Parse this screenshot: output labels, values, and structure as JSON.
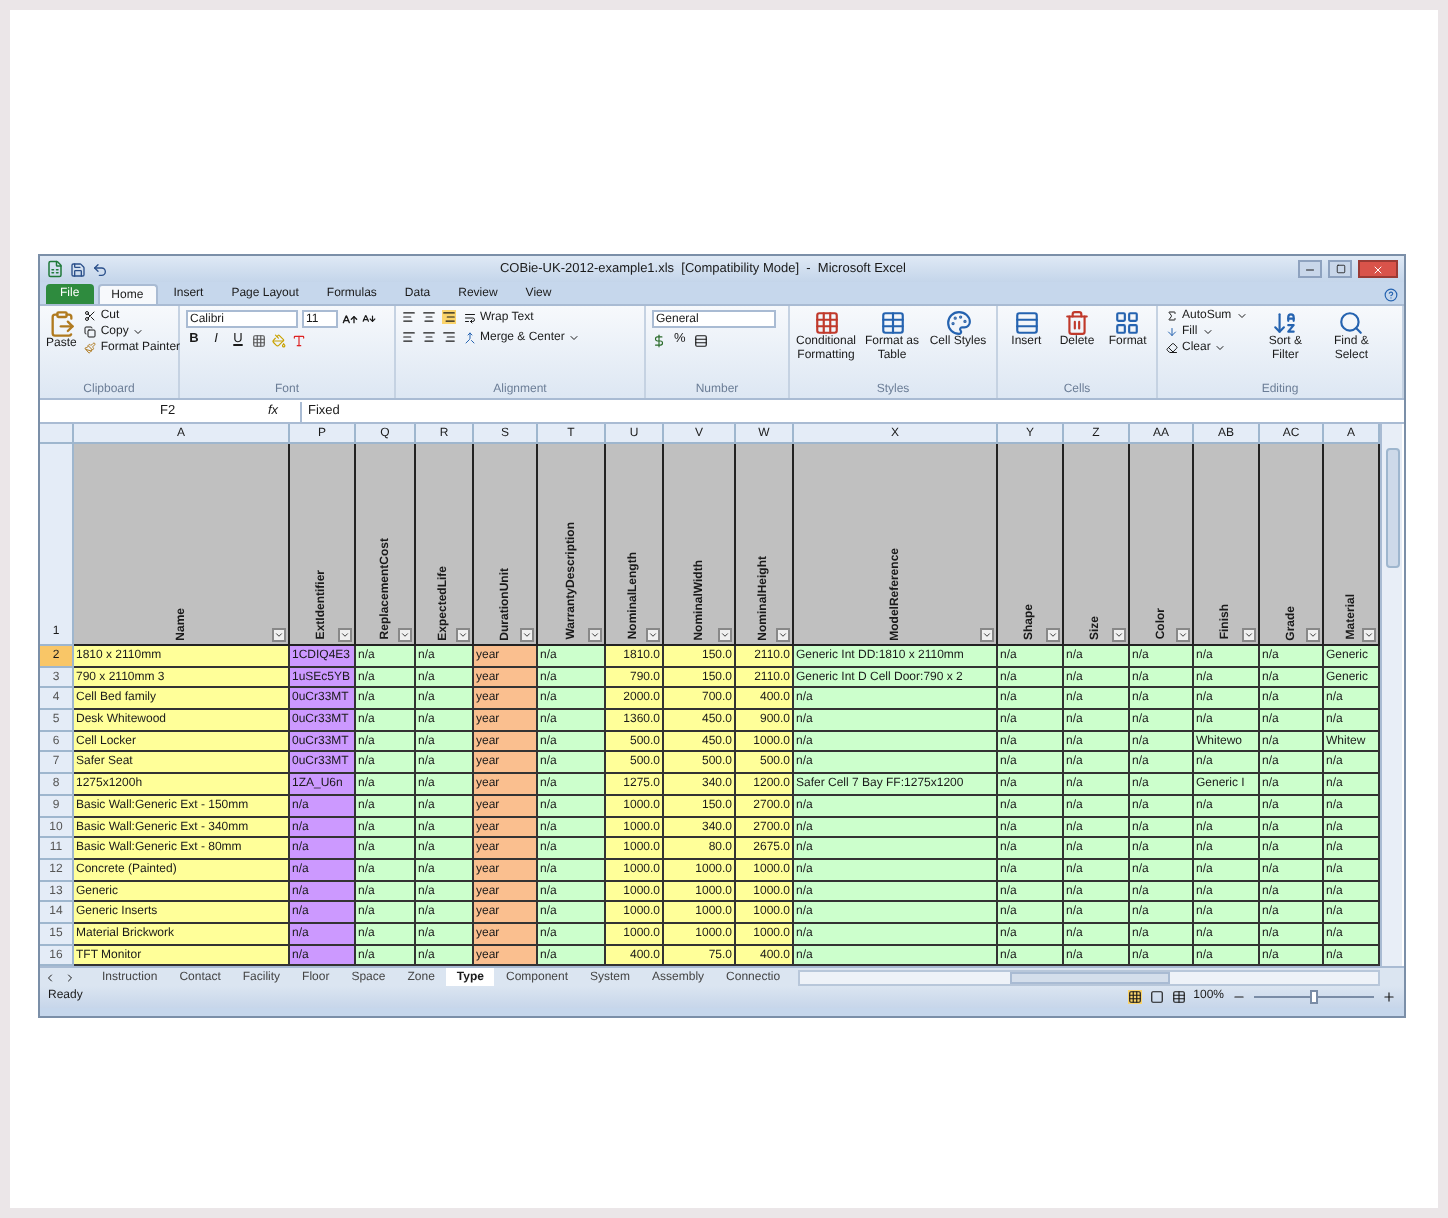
{
  "window": {
    "title": "COBie-UK-2012-example1.xls  [Compatibility Mode]  -  Microsoft Excel"
  },
  "ribbon_tabs": {
    "file": "File",
    "tabs": [
      {
        "label": "Home",
        "selected": true
      },
      {
        "label": "Insert",
        "selected": false
      },
      {
        "label": "Page Layout",
        "selected": false
      },
      {
        "label": "Formulas",
        "selected": false
      },
      {
        "label": "Data",
        "selected": false
      },
      {
        "label": "Review",
        "selected": false
      },
      {
        "label": "View",
        "selected": false
      }
    ]
  },
  "ribbon": {
    "clipboard": {
      "label": "Clipboard",
      "paste": "Paste",
      "cut": "Cut",
      "copy": "Copy",
      "format_painter": "Format Painter"
    },
    "font": {
      "label": "Font",
      "font_name": "Calibri",
      "font_size": "11",
      "styles": [
        "B",
        "I",
        "U"
      ]
    },
    "alignment": {
      "label": "Alignment",
      "wrap_text": "Wrap Text",
      "merge_center": "Merge & Center"
    },
    "number": {
      "label": "Number",
      "format": "General",
      "percent": "%"
    },
    "styles": {
      "label": "Styles",
      "buttons": [
        "Conditional Formatting",
        "Format as Table",
        "Cell Styles"
      ]
    },
    "cells": {
      "label": "Cells",
      "buttons": [
        "Insert",
        "Delete",
        "Format"
      ]
    },
    "editing": {
      "label": "Editing",
      "autosum": "AutoSum",
      "fill": "Fill",
      "clear": "Clear",
      "sort_filter": "Sort & Filter",
      "find_select": "Find & Select"
    }
  },
  "formula_bar": {
    "name_box": "F2",
    "fx": "fx",
    "value": "Fixed"
  },
  "header_row_number": "1",
  "columns": [
    {
      "letter": "A",
      "name": "Name",
      "color": "#ffff99",
      "kind": "text"
    },
    {
      "letter": "P",
      "name": "ExtIdentifier",
      "color": "#cc99ff",
      "kind": "text"
    },
    {
      "letter": "Q",
      "name": "ReplacementCost",
      "color": "#ccffcc",
      "kind": "text"
    },
    {
      "letter": "R",
      "name": "ExpectedLife",
      "color": "#ccffcc",
      "kind": "text"
    },
    {
      "letter": "S",
      "name": "DurationUnit",
      "color": "#fabf8f",
      "kind": "text"
    },
    {
      "letter": "T",
      "name": "WarrantyDescription",
      "color": "#ccffcc",
      "kind": "text"
    },
    {
      "letter": "U",
      "name": "NominalLength",
      "color": "#ffff99",
      "kind": "number"
    },
    {
      "letter": "V",
      "name": "NominalWidth",
      "color": "#ffff99",
      "kind": "number"
    },
    {
      "letter": "W",
      "name": "NominalHeight",
      "color": "#ffff99",
      "kind": "number"
    },
    {
      "letter": "X",
      "name": "ModelReference",
      "color": "#ccffcc",
      "kind": "text"
    },
    {
      "letter": "Y",
      "name": "Shape",
      "color": "#ccffcc",
      "kind": "text"
    },
    {
      "letter": "Z",
      "name": "Size",
      "color": "#ccffcc",
      "kind": "text"
    },
    {
      "letter": "AA",
      "name": "Color",
      "color": "#ccffcc",
      "kind": "text"
    },
    {
      "letter": "AB",
      "name": "Finish",
      "color": "#ccffcc",
      "kind": "text"
    },
    {
      "letter": "AC",
      "name": "Grade",
      "color": "#ccffcc",
      "kind": "text"
    },
    {
      "letter": "A",
      "name": "Material",
      "color": "#ccffcc",
      "kind": "text"
    }
  ],
  "rows": [
    {
      "number": "2",
      "selected": true,
      "cells": [
        "1810 x 2110mm",
        "1CDIQ4E3",
        "n/a",
        "n/a",
        "year",
        "n/a",
        "1810.0",
        "150.0",
        "2110.0",
        "Generic Int DD:1810 x 2110mm",
        "n/a",
        "n/a",
        "n/a",
        "n/a",
        "n/a",
        "Generic"
      ]
    },
    {
      "number": "3",
      "selected": false,
      "cells": [
        "790 x 2110mm 3",
        "1uSEc5YB",
        "n/a",
        "n/a",
        "year",
        "n/a",
        "790.0",
        "150.0",
        "2110.0",
        "Generic Int D Cell Door:790 x 2",
        "n/a",
        "n/a",
        "n/a",
        "n/a",
        "n/a",
        "Generic"
      ]
    },
    {
      "number": "4",
      "selected": false,
      "cells": [
        "Cell Bed family",
        "0uCr33MT",
        "n/a",
        "n/a",
        "year",
        "n/a",
        "2000.0",
        "700.0",
        "400.0",
        "n/a",
        "n/a",
        "n/a",
        "n/a",
        "n/a",
        "n/a",
        "n/a"
      ]
    },
    {
      "number": "5",
      "selected": false,
      "cells": [
        "Desk Whitewood",
        "0uCr33MT",
        "n/a",
        "n/a",
        "year",
        "n/a",
        "1360.0",
        "450.0",
        "900.0",
        "n/a",
        "n/a",
        "n/a",
        "n/a",
        "n/a",
        "n/a",
        "n/a"
      ]
    },
    {
      "number": "6",
      "selected": false,
      "cells": [
        "Cell Locker",
        "0uCr33MT",
        "n/a",
        "n/a",
        "year",
        "n/a",
        "500.0",
        "450.0",
        "1000.0",
        "n/a",
        "n/a",
        "n/a",
        "n/a",
        "Whitewo",
        "n/a",
        "Whitew"
      ]
    },
    {
      "number": "7",
      "selected": false,
      "cells": [
        "Safer Seat",
        "0uCr33MT",
        "n/a",
        "n/a",
        "year",
        "n/a",
        "500.0",
        "500.0",
        "500.0",
        "n/a",
        "n/a",
        "n/a",
        "n/a",
        "n/a",
        "n/a",
        "n/a"
      ]
    },
    {
      "number": "8",
      "selected": false,
      "cells": [
        "1275x1200h",
        "1ZA_U6n",
        "n/a",
        "n/a",
        "year",
        "n/a",
        "1275.0",
        "340.0",
        "1200.0",
        "Safer Cell 7 Bay FF:1275x1200",
        "n/a",
        "n/a",
        "n/a",
        "Generic I",
        "n/a",
        "n/a"
      ]
    },
    {
      "number": "9",
      "selected": false,
      "cells": [
        "Basic Wall:Generic Ext - 150mm",
        "n/a",
        "n/a",
        "n/a",
        "year",
        "n/a",
        "1000.0",
        "150.0",
        "2700.0",
        "n/a",
        "n/a",
        "n/a",
        "n/a",
        "n/a",
        "n/a",
        "n/a"
      ]
    },
    {
      "number": "10",
      "selected": false,
      "cells": [
        "Basic Wall:Generic Ext - 340mm",
        "n/a",
        "n/a",
        "n/a",
        "year",
        "n/a",
        "1000.0",
        "340.0",
        "2700.0",
        "n/a",
        "n/a",
        "n/a",
        "n/a",
        "n/a",
        "n/a",
        "n/a"
      ]
    },
    {
      "number": "11",
      "selected": false,
      "cells": [
        "Basic Wall:Generic Ext - 80mm",
        "n/a",
        "n/a",
        "n/a",
        "year",
        "n/a",
        "1000.0",
        "80.0",
        "2675.0",
        "n/a",
        "n/a",
        "n/a",
        "n/a",
        "n/a",
        "n/a",
        "n/a"
      ]
    },
    {
      "number": "12",
      "selected": false,
      "cells": [
        "Concrete (Painted)",
        "n/a",
        "n/a",
        "n/a",
        "year",
        "n/a",
        "1000.0",
        "1000.0",
        "1000.0",
        "n/a",
        "n/a",
        "n/a",
        "n/a",
        "n/a",
        "n/a",
        "n/a"
      ]
    },
    {
      "number": "13",
      "selected": false,
      "cells": [
        "Generic",
        "n/a",
        "n/a",
        "n/a",
        "year",
        "n/a",
        "1000.0",
        "1000.0",
        "1000.0",
        "n/a",
        "n/a",
        "n/a",
        "n/a",
        "n/a",
        "n/a",
        "n/a"
      ]
    },
    {
      "number": "14",
      "selected": false,
      "cells": [
        "Generic Inserts",
        "n/a",
        "n/a",
        "n/a",
        "year",
        "n/a",
        "1000.0",
        "1000.0",
        "1000.0",
        "n/a",
        "n/a",
        "n/a",
        "n/a",
        "n/a",
        "n/a",
        "n/a"
      ]
    },
    {
      "number": "15",
      "selected": false,
      "cells": [
        "Material Brickwork",
        "n/a",
        "n/a",
        "n/a",
        "year",
        "n/a",
        "1000.0",
        "1000.0",
        "1000.0",
        "n/a",
        "n/a",
        "n/a",
        "n/a",
        "n/a",
        "n/a",
        "n/a"
      ]
    },
    {
      "number": "16",
      "selected": false,
      "cells": [
        "TFT Monitor",
        "n/a",
        "n/a",
        "n/a",
        "year",
        "n/a",
        "400.0",
        "75.0",
        "400.0",
        "n/a",
        "n/a",
        "n/a",
        "n/a",
        "n/a",
        "n/a",
        "n/a"
      ]
    }
  ],
  "sheet_tabs": [
    {
      "label": "Instruction",
      "selected": false
    },
    {
      "label": "Contact",
      "selected": false
    },
    {
      "label": "Facility",
      "selected": false
    },
    {
      "label": "Floor",
      "selected": false
    },
    {
      "label": "Space",
      "selected": false
    },
    {
      "label": "Zone",
      "selected": false
    },
    {
      "label": "Type",
      "selected": true
    },
    {
      "label": "Component",
      "selected": false
    },
    {
      "label": "System",
      "selected": false
    },
    {
      "label": "Assembly",
      "selected": false
    },
    {
      "label": "Connectio",
      "selected": false
    }
  ],
  "status_bar": {
    "status": "Ready",
    "zoom": "100%",
    "zoom_slider": {
      "level": 0.5
    }
  }
}
